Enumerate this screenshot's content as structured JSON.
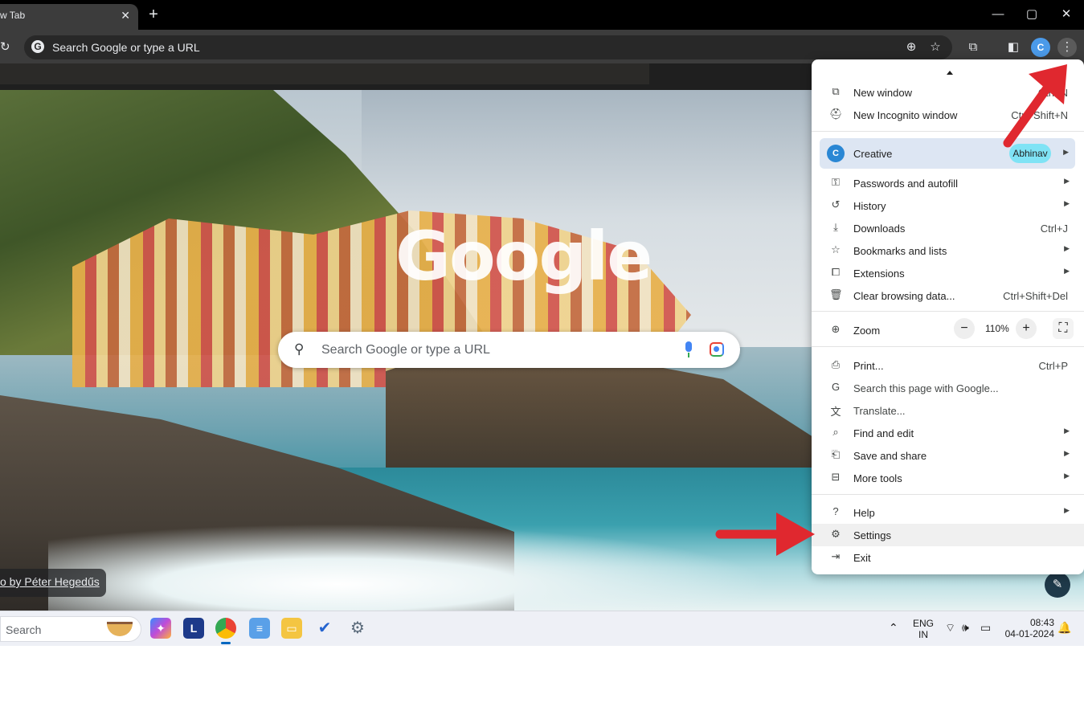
{
  "tab": {
    "title": "w Tab",
    "close_glyph": "✕"
  },
  "new_tab_glyph": "+",
  "window_controls": {
    "minimize": "—",
    "maximize": "▢",
    "close": "✕"
  },
  "omnibox": {
    "placeholder": "Search Google or type a URL",
    "g_glyph": "G"
  },
  "toolbar_icons": [
    "reload-icon",
    "zoom-icon",
    "star-icon",
    "extensions-icon",
    "side-panel-icon",
    "profile-icon",
    "menu-icon"
  ],
  "ntp": {
    "logo": "Google",
    "search_placeholder": "Search Google or type a URL",
    "photo_credit": "o by Péter Hegedűs"
  },
  "menu": {
    "new_window": {
      "label": "New window",
      "shortcut": "Ctrl+N"
    },
    "new_incognito": {
      "label": "New Incognito window",
      "shortcut": "Ctrl+Shift+N"
    },
    "profile": {
      "label": "Creative",
      "chip": "Abhinav"
    },
    "passwords": {
      "label": "Passwords and autofill"
    },
    "history": {
      "label": "History"
    },
    "downloads": {
      "label": "Downloads",
      "shortcut": "Ctrl+J"
    },
    "bookmarks": {
      "label": "Bookmarks and lists"
    },
    "extensions": {
      "label": "Extensions"
    },
    "clear": {
      "label": "Clear browsing data...",
      "shortcut": "Ctrl+Shift+Del"
    },
    "zoom": {
      "label": "Zoom",
      "value": "110%",
      "minus": "−",
      "plus": "+"
    },
    "print": {
      "label": "Print...",
      "shortcut": "Ctrl+P"
    },
    "search_page": {
      "label": "Search this page with Google..."
    },
    "translate": {
      "label": "Translate..."
    },
    "find_edit": {
      "label": "Find and edit"
    },
    "save_share": {
      "label": "Save and share"
    },
    "more_tools": {
      "label": "More tools"
    },
    "help": {
      "label": "Help"
    },
    "settings": {
      "label": "Settings"
    },
    "exit": {
      "label": "Exit"
    }
  },
  "taskbar": {
    "search_label": "Search",
    "lang_top": "ENG",
    "lang_bottom": "IN",
    "time": "08:43",
    "date": "04-01-2024"
  },
  "colors": {
    "annotation_arrow": "#e0282f",
    "menu_highlight": "#f0f0f0",
    "profile_chip": "#7fe3f5"
  }
}
